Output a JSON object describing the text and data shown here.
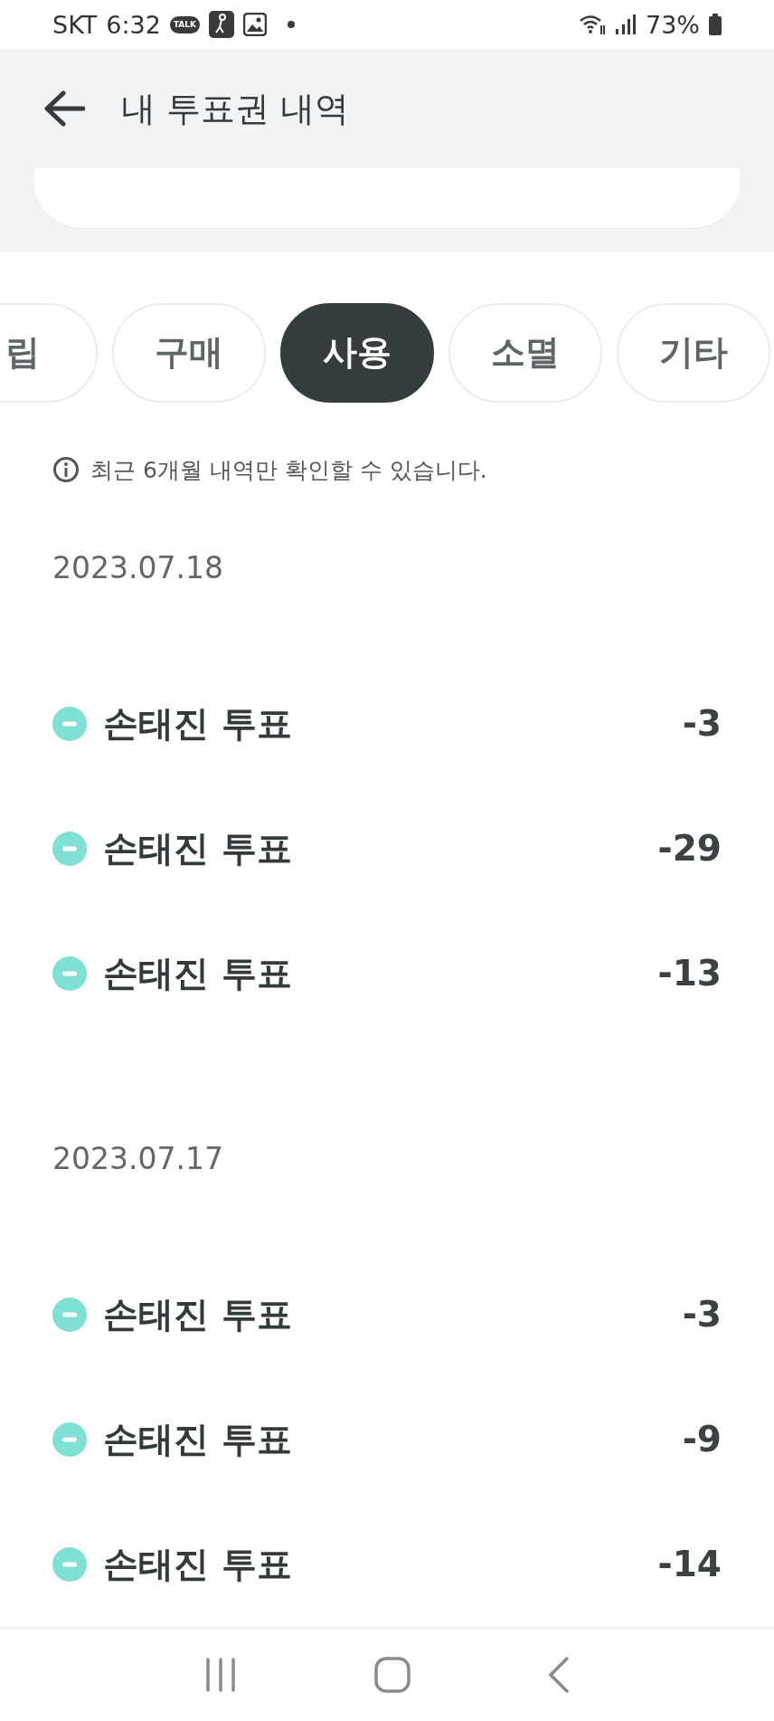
{
  "status_bar": {
    "carrier": "SKT",
    "time": "6:32",
    "talk_badge": "TALK",
    "battery": "73%"
  },
  "header": {
    "title": "내 투표권 내역"
  },
  "tabs": [
    {
      "label": "립",
      "selected": false
    },
    {
      "label": "구매",
      "selected": false
    },
    {
      "label": "사용",
      "selected": true
    },
    {
      "label": "소멸",
      "selected": false
    },
    {
      "label": "기타",
      "selected": false
    }
  ],
  "notice": "최근 6개월 내역만 확인할 수 있습니다.",
  "groups": [
    {
      "date": "2023.07.18",
      "items": [
        {
          "name": "손태진 투표",
          "amount": "-3"
        },
        {
          "name": "손태진 투표",
          "amount": "-29"
        },
        {
          "name": "손태진 투표",
          "amount": "-13"
        }
      ]
    },
    {
      "date": "2023.07.17",
      "items": [
        {
          "name": "손태진 투표",
          "amount": "-3"
        },
        {
          "name": "손태진 투표",
          "amount": "-9"
        },
        {
          "name": "손태진 투표",
          "amount": "-14"
        }
      ]
    }
  ]
}
